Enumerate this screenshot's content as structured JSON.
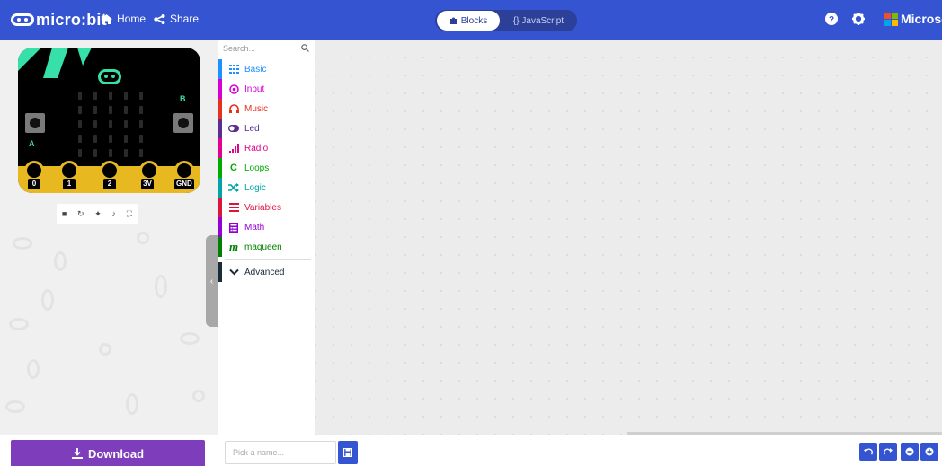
{
  "header": {
    "brand": "micro:bit",
    "home_label": "Home",
    "share_label": "Share",
    "editor_toggle": {
      "blocks_label": "Blocks",
      "javascript_label": "{} JavaScript",
      "active": "blocks"
    },
    "microsoft_label": "Microsoft",
    "icons": [
      "home-icon",
      "share-icon",
      "puzzle-icon",
      "help-icon",
      "settings-icon"
    ],
    "accent_color": "#3454d1"
  },
  "simulator": {
    "pin_labels": [
      "0",
      "1",
      "2",
      "3V",
      "GND"
    ],
    "button_labels": [
      "A",
      "B"
    ],
    "controls": [
      "stop-icon",
      "restart-icon",
      "debug-icon",
      "mute-icon",
      "fullscreen-icon"
    ],
    "board_color": "#000000",
    "pin_color": "#e8b820"
  },
  "toolbox": {
    "search_placeholder": "Search...",
    "categories": [
      {
        "label": "Basic",
        "color": "#1e90ff",
        "icon": "grid-icon"
      },
      {
        "label": "Input",
        "color": "#d400d4",
        "icon": "target-icon"
      },
      {
        "label": "Music",
        "color": "#e63022",
        "icon": "headphones-icon"
      },
      {
        "label": "Led",
        "color": "#5c2d91",
        "icon": "toggle-icon"
      },
      {
        "label": "Radio",
        "color": "#e3008c",
        "icon": "signal-icon"
      },
      {
        "label": "Loops",
        "color": "#00aa00",
        "icon": "loop-icon"
      },
      {
        "label": "Logic",
        "color": "#00a4a6",
        "icon": "shuffle-icon"
      },
      {
        "label": "Variables",
        "color": "#dc143c",
        "icon": "lines-icon"
      },
      {
        "label": "Math",
        "color": "#9400d3",
        "icon": "calculator-icon"
      },
      {
        "label": "maqueen",
        "color": "#008000",
        "icon": "m-icon"
      }
    ],
    "advanced_label": "Advanced"
  },
  "bottom": {
    "download_label": "Download",
    "name_placeholder": "Pick a name..."
  }
}
